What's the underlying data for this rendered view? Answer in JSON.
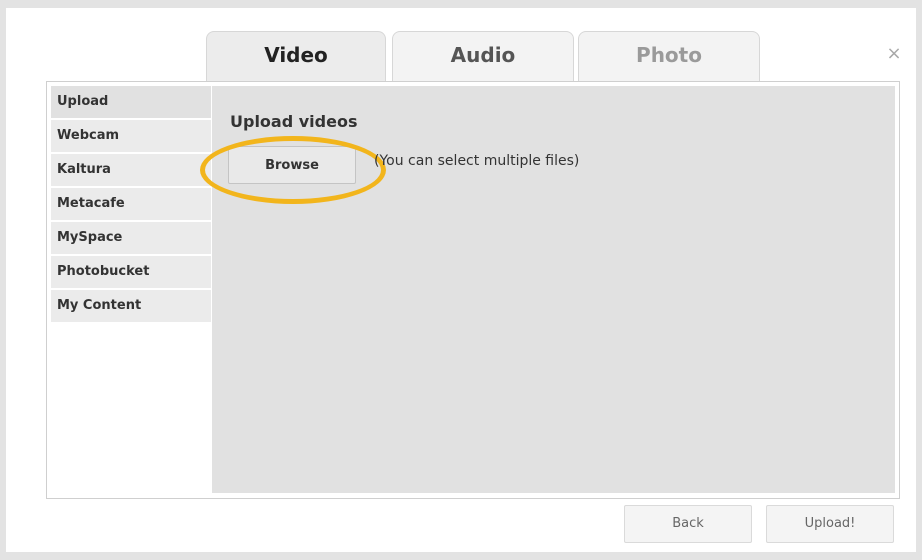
{
  "tabs": [
    {
      "label": "Video",
      "state": "active"
    },
    {
      "label": "Audio",
      "state": "inactive"
    },
    {
      "label": "Photo",
      "state": "disabled"
    }
  ],
  "close_label": "×",
  "sidebar": {
    "items": [
      {
        "label": "Upload",
        "active": true
      },
      {
        "label": "Webcam"
      },
      {
        "label": "Kaltura"
      },
      {
        "label": "Metacafe"
      },
      {
        "label": "MySpace"
      },
      {
        "label": "Photobucket"
      },
      {
        "label": "My Content"
      }
    ]
  },
  "main": {
    "heading": "Upload videos",
    "browse_label": "Browse",
    "hint": "(You can select multiple files)"
  },
  "footer": {
    "back_label": "Back",
    "upload_label": "Upload!"
  },
  "colors": {
    "highlight": "#f2b51c",
    "content_bg": "#e1e1e1"
  }
}
